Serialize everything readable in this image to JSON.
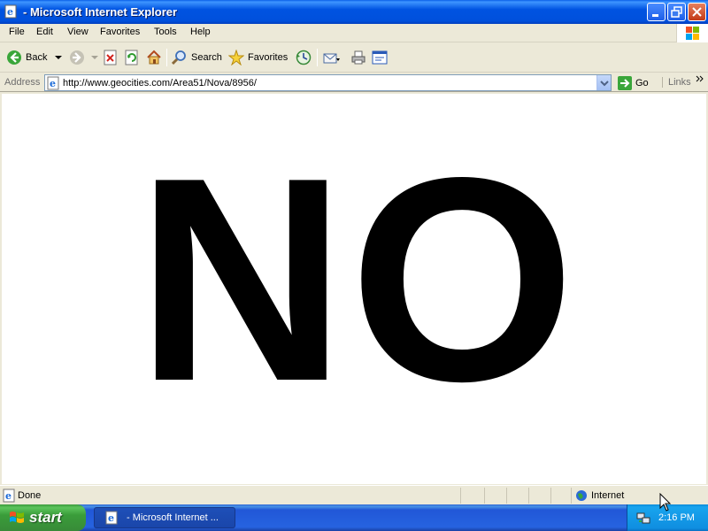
{
  "window": {
    "title": "- Microsoft Internet Explorer",
    "buttons": [
      "minimize",
      "restore",
      "close"
    ]
  },
  "menubar": {
    "items": [
      "File",
      "Edit",
      "View",
      "Favorites",
      "Tools",
      "Help"
    ]
  },
  "toolbar": {
    "back_label": "Back",
    "search_label": "Search",
    "favorites_label": "Favorites",
    "icons": [
      "back-icon",
      "forward-icon",
      "stop-icon",
      "refresh-icon",
      "home-icon",
      "search-icon",
      "favorites-star-icon",
      "history-icon",
      "mail-icon",
      "print-icon",
      "edit-icon"
    ]
  },
  "addressbar": {
    "label": "Address",
    "url": "http://www.geocities.com/Area51/Nova/8956/",
    "go_label": "Go",
    "links_label": "Links"
  },
  "page": {
    "big_text": "NO"
  },
  "statusbar": {
    "status": "Done",
    "zone": "Internet"
  },
  "taskbar": {
    "start_label": "start",
    "task_label": "- Microsoft Internet ...",
    "clock": "2:16 PM"
  },
  "colors": {
    "titlebar_blue": "#0053e1",
    "taskbar_blue": "#2663e0",
    "start_green": "#3a9d3a",
    "chrome_beige": "#ece9d8"
  }
}
